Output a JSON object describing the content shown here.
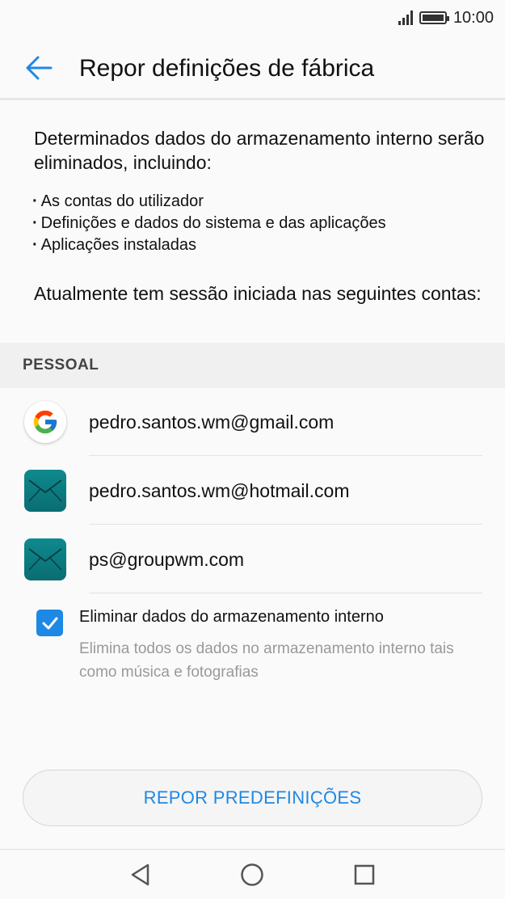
{
  "status_bar": {
    "time": "10:00",
    "icons": [
      "signal-icon",
      "battery-icon"
    ]
  },
  "app_bar": {
    "title": "Repor definições de fábrica",
    "back_icon": "arrow-left-icon",
    "accent_color": "#1e88e5"
  },
  "content": {
    "description": "Determinados dados do armazenamento interno serão eliminados, incluindo:",
    "bullets": [
      "As contas do utilizador",
      "Definições e dados do sistema e das aplicações",
      "Aplicações instaladas"
    ],
    "session_text": "Atualmente tem sessão iniciada nas seguintes contas:"
  },
  "accounts_section": {
    "header": "PESSOAL",
    "accounts": [
      {
        "email": "pedro.santos.wm@gmail.com",
        "icon": "google-icon"
      },
      {
        "email": "pedro.santos.wm@hotmail.com",
        "icon": "mail-icon"
      },
      {
        "email": "ps@groupwm.com",
        "icon": "mail-icon"
      }
    ]
  },
  "erase_option": {
    "checked": true,
    "label": "Eliminar dados do armazenamento interno",
    "sublabel": "Elimina todos os dados no armazenamento interno tais como música e fotografias"
  },
  "reset_button": {
    "label": "REPOR PREDEFINIÇÕES"
  },
  "nav_bar": {
    "buttons": [
      "back-triangle-icon",
      "home-circle-icon",
      "recents-square-icon"
    ]
  }
}
